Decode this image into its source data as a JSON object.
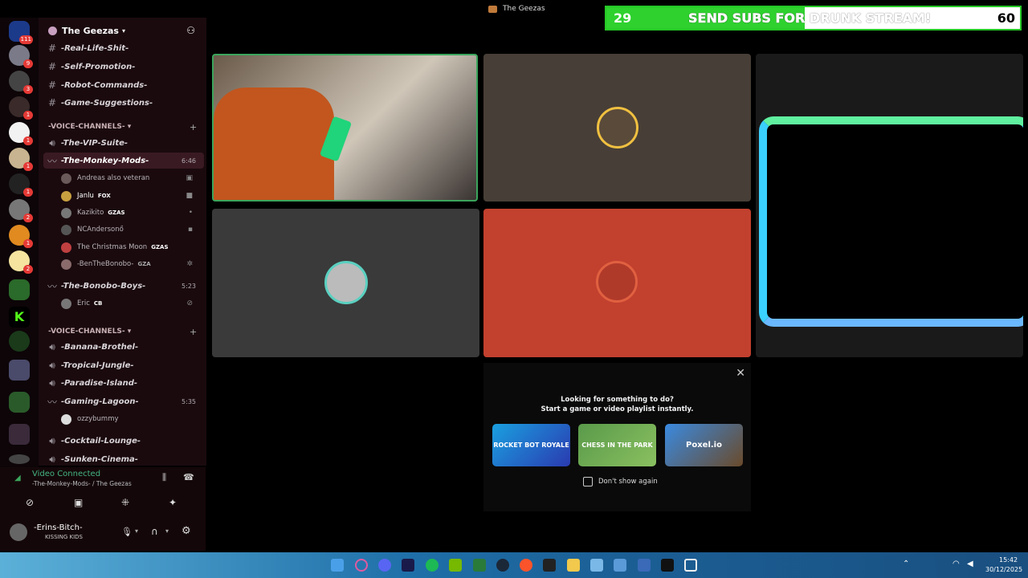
{
  "window": {
    "title": "The Geezas"
  },
  "subs_bar": {
    "left": "29",
    "text": "SEND SUBS FOR DRUNK STREAM!",
    "right": "60",
    "progress": 0.48
  },
  "server": {
    "name": "The Geezas"
  },
  "channels": [
    {
      "name": "-Real-Life-Shit-",
      "kind": "text"
    },
    {
      "name": "-Self-Promotion-",
      "kind": "text"
    },
    {
      "name": "-Robot-Commands-",
      "kind": "text"
    },
    {
      "name": "-Game-Suggestions-",
      "kind": "text"
    }
  ],
  "category1": "-VOICE-CHANNELS-",
  "voice1": [
    {
      "name": "-The-VIP-Suite-"
    },
    {
      "name": "-The-Monkey-Mods-",
      "time": "6:46"
    }
  ],
  "monkey_users": [
    {
      "name": "Andreas also veteran",
      "tag": ""
    },
    {
      "name": "Janlu",
      "tag": "FOX"
    },
    {
      "name": "Kazikito",
      "tag": "GZAS"
    },
    {
      "name": "NCAndersonő",
      "tag": ""
    },
    {
      "name": "The Christmas Moon",
      "tag": "GZAS"
    },
    {
      "name": "-BenTheBonobo-",
      "tag": "GZA"
    }
  ],
  "bonobo": {
    "name": "-The-Bonobo-Boys-",
    "time": "5:23",
    "user": "Eric",
    "user_tag": "CB"
  },
  "category2": "-VOICE-CHANNELS-",
  "voice2": [
    {
      "name": "-Banana-Brothel-"
    },
    {
      "name": "-Tropical-Jungle-"
    },
    {
      "name": "-Paradise-Island-"
    },
    {
      "name": "-Gaming-Lagoon-",
      "time": "5:35"
    }
  ],
  "lagoon_user": "ozzybummy",
  "voice3": [
    {
      "name": "-Cocktail-Lounge-"
    },
    {
      "name": "-Sunken-Cinema-"
    }
  ],
  "voice_status": {
    "title": "Video Connected",
    "sub": "-The-Monkey-Mods- / The Geezas"
  },
  "self_user": {
    "name": "-Erins-Bitch-",
    "status": "KISSING KIDS"
  },
  "activity": {
    "line1": "Looking for something to do?",
    "line2": "Start a game or video playlist instantly.",
    "games": [
      "ROCKET BOT ROYALE",
      "CHESS IN THE PARK",
      "Poxel.io"
    ],
    "dont_show": "Don't show again"
  },
  "clock": {
    "time": "15:42",
    "date": "30/12/2025"
  }
}
